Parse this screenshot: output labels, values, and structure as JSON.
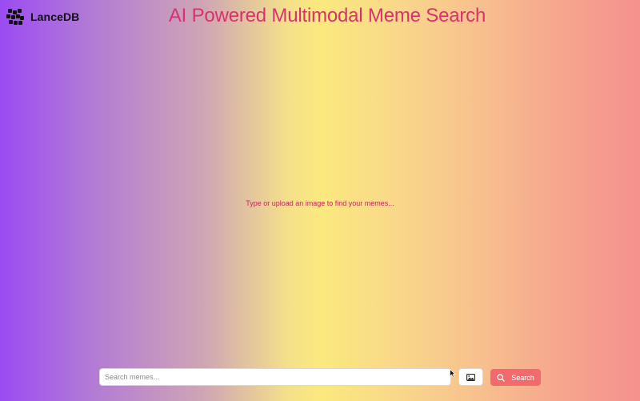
{
  "brand": {
    "name": "LanceDB",
    "logo_icon": "lancedb-logo-icon"
  },
  "header": {
    "title": "AI Powered Multimodal Meme Search",
    "title_color": "#d8326e"
  },
  "main": {
    "empty_state_text": "Type or upload an image to find your memes..."
  },
  "search": {
    "placeholder": "Search memes...",
    "value": "",
    "image_button_icon": "image-icon",
    "submit_label": "Search",
    "submit_icon": "search-icon",
    "submit_color": "#f26a6d"
  },
  "colors": {
    "gradient": [
      "#9b4bf2",
      "#cfa6b4",
      "#fbe97e",
      "#f7c08e",
      "#f5918e"
    ]
  }
}
